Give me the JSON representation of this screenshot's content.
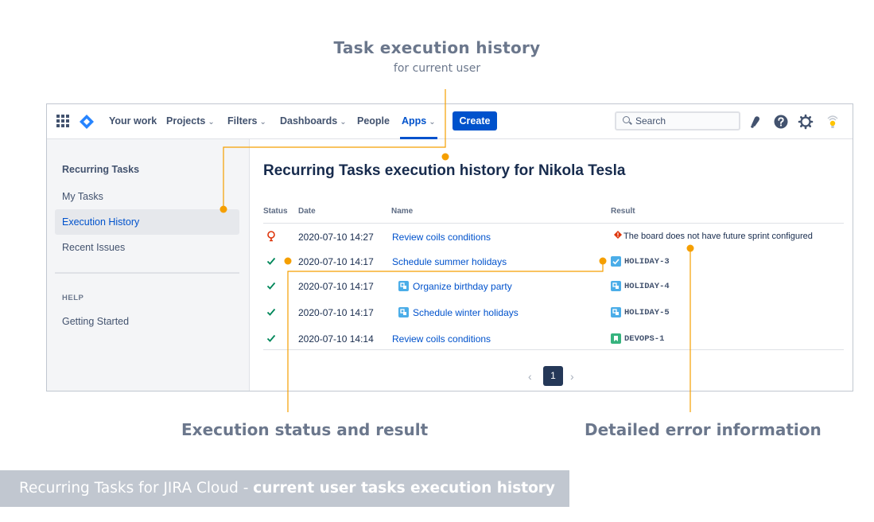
{
  "hero": {
    "title": "Task execution history",
    "subtitle": "for current user"
  },
  "topnav": {
    "items": [
      {
        "label": "Your work",
        "has_chevron": false
      },
      {
        "label": "Projects",
        "has_chevron": true
      },
      {
        "label": "Filters",
        "has_chevron": true
      },
      {
        "label": "Dashboards",
        "has_chevron": true
      },
      {
        "label": "People",
        "has_chevron": false
      },
      {
        "label": "Apps",
        "has_chevron": true,
        "active": true
      }
    ],
    "chevron": "⌄",
    "create_label": "Create",
    "search_placeholder": "Search",
    "icons": [
      "apps-grid-icon",
      "jira-logo-icon",
      "notifications-icon",
      "help-icon",
      "settings-icon",
      "profile-icon"
    ]
  },
  "sidebar": {
    "title": "Recurring Tasks",
    "items": [
      "My Tasks",
      "Execution History",
      "Recent Issues"
    ],
    "selected": "Execution History",
    "help_header": "HELP",
    "help_items": [
      "Getting Started"
    ]
  },
  "main": {
    "title": "Recurring Tasks execution history for Nikola Tesla",
    "columns": [
      "Status",
      "Date",
      "Name",
      "Result"
    ],
    "rows": [
      {
        "status": "failed",
        "date": "2020-07-10 14:27",
        "name": "Review coils conditions",
        "subtask": false,
        "result": "The board does not have future sprint configured",
        "result_type": "error"
      },
      {
        "status": "success",
        "date": "2020-07-10 14:17",
        "name": "Schedule summer holidays",
        "subtask": false,
        "result": "HOLIDAY-3",
        "result_type": "task"
      },
      {
        "status": "success",
        "date": "2020-07-10 14:17",
        "name": "Organize birthday party",
        "subtask": true,
        "result": "HOLIDAY-4",
        "result_type": "subtask"
      },
      {
        "status": "success",
        "date": "2020-07-10 14:17",
        "name": "Schedule winter holidays",
        "subtask": true,
        "result": "HOLIDAY-5",
        "result_type": "subtask"
      },
      {
        "status": "success",
        "date": "2020-07-10 14:14",
        "name": "Review coils conditions",
        "subtask": false,
        "result": "DEVOPS-1",
        "result_type": "story"
      }
    ],
    "pagination": {
      "prev": "‹",
      "current": "1",
      "next": "›"
    }
  },
  "callouts": {
    "status": "Execution status and result",
    "error": "Detailed error information"
  },
  "banner": {
    "prefix": "Recurring Tasks for JIRA Cloud - ",
    "bold": "current user tasks execution history"
  },
  "colors": {
    "accent": "#0052cc",
    "callout_orange": "#f59f00",
    "success": "#00875a",
    "failure": "#de350b",
    "banner_bg": "#c1c7d0"
  }
}
